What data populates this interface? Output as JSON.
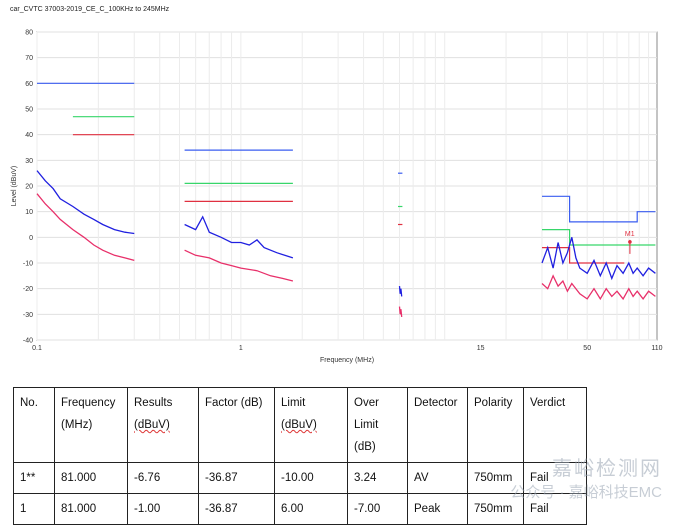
{
  "chart_data": {
    "type": "line",
    "title": "car_CVTC 37003-2019_CE_C_100KHz to 245MHz",
    "xlabel": "Frequency (MHz)",
    "ylabel": "Level (dBuV)",
    "xscale": "log",
    "xlim": [
      0.1,
      110
    ],
    "ylim": [
      -40,
      80
    ],
    "yticks": [
      80,
      70,
      60,
      50,
      40,
      30,
      20,
      10,
      0,
      -10,
      -20,
      -30,
      -40
    ],
    "xticks": [
      0.1,
      1,
      15,
      50,
      110
    ],
    "xtick_labels": [
      "0.1",
      "1",
      "15",
      "50",
      "110"
    ],
    "grid": true,
    "limit_lines": [
      {
        "color": "#3a5df0",
        "points": [
          [
            0.1,
            60
          ],
          [
            0.3,
            60
          ]
        ]
      },
      {
        "color": "#37d66a",
        "points": [
          [
            0.15,
            47
          ],
          [
            0.3,
            47
          ]
        ]
      },
      {
        "color": "#e03040",
        "points": [
          [
            0.15,
            40
          ],
          [
            0.3,
            40
          ]
        ]
      },
      {
        "color": "#3a5df0",
        "points": [
          [
            0.53,
            34
          ],
          [
            1.8,
            34
          ]
        ]
      },
      {
        "color": "#37d66a",
        "points": [
          [
            0.53,
            21
          ],
          [
            1.8,
            21
          ]
        ]
      },
      {
        "color": "#e03040",
        "points": [
          [
            0.53,
            14
          ],
          [
            1.8,
            14
          ]
        ]
      },
      {
        "color": "#3a5df0",
        "points": [
          [
            5.9,
            25
          ],
          [
            6.2,
            25
          ]
        ]
      },
      {
        "color": "#37d66a",
        "points": [
          [
            5.9,
            12
          ],
          [
            6.2,
            12
          ]
        ]
      },
      {
        "color": "#e03040",
        "points": [
          [
            5.9,
            5
          ],
          [
            6.2,
            5
          ]
        ]
      },
      {
        "color": "#3a5df0",
        "points": [
          [
            30,
            16
          ],
          [
            41,
            16
          ],
          [
            41,
            6
          ],
          [
            76,
            6
          ],
          [
            76,
            6
          ],
          [
            88,
            6
          ],
          [
            88,
            10
          ],
          [
            108,
            10
          ]
        ]
      },
      {
        "color": "#37d66a",
        "points": [
          [
            30,
            3
          ],
          [
            41,
            3
          ],
          [
            41,
            -3
          ],
          [
            76,
            -3
          ],
          [
            76,
            -3
          ],
          [
            108,
            -3
          ]
        ]
      },
      {
        "color": "#e03040",
        "points": [
          [
            30,
            -4
          ],
          [
            41,
            -4
          ],
          [
            41,
            -10
          ],
          [
            76,
            -10
          ]
        ]
      }
    ],
    "series": [
      {
        "color": "#2020e0",
        "points": [
          [
            0.1,
            26
          ],
          [
            0.11,
            22
          ],
          [
            0.12,
            19
          ],
          [
            0.13,
            15
          ],
          [
            0.15,
            12
          ],
          [
            0.17,
            9
          ],
          [
            0.19,
            7
          ],
          [
            0.21,
            5
          ],
          [
            0.24,
            3
          ],
          [
            0.27,
            2
          ],
          [
            0.3,
            1.5
          ]
        ]
      },
      {
        "color": "#e8306a",
        "points": [
          [
            0.1,
            17
          ],
          [
            0.11,
            13
          ],
          [
            0.12,
            10
          ],
          [
            0.13,
            7
          ],
          [
            0.15,
            3
          ],
          [
            0.17,
            0
          ],
          [
            0.19,
            -3
          ],
          [
            0.21,
            -5
          ],
          [
            0.24,
            -7
          ],
          [
            0.27,
            -8
          ],
          [
            0.3,
            -9
          ]
        ]
      },
      {
        "color": "#2020e0",
        "points": [
          [
            0.53,
            5
          ],
          [
            0.6,
            3
          ],
          [
            0.65,
            8
          ],
          [
            0.7,
            2
          ],
          [
            0.8,
            0
          ],
          [
            0.9,
            -2
          ],
          [
            1.0,
            -2
          ],
          [
            1.1,
            -3
          ],
          [
            1.2,
            -1
          ],
          [
            1.3,
            -4
          ],
          [
            1.5,
            -6
          ],
          [
            1.8,
            -8
          ]
        ]
      },
      {
        "color": "#e8306a",
        "points": [
          [
            0.53,
            -5
          ],
          [
            0.6,
            -7
          ],
          [
            0.7,
            -8
          ],
          [
            0.8,
            -10
          ],
          [
            0.9,
            -11
          ],
          [
            1.0,
            -12
          ],
          [
            1.2,
            -13
          ],
          [
            1.4,
            -15
          ],
          [
            1.6,
            -16
          ],
          [
            1.8,
            -17
          ]
        ]
      },
      {
        "color": "#2020e0",
        "points": [
          [
            6.0,
            -19
          ],
          [
            6.05,
            -22
          ],
          [
            6.1,
            -20
          ],
          [
            6.15,
            -23
          ]
        ]
      },
      {
        "color": "#e8306a",
        "points": [
          [
            6.0,
            -27
          ],
          [
            6.05,
            -30
          ],
          [
            6.1,
            -28
          ],
          [
            6.15,
            -31
          ]
        ]
      },
      {
        "color": "#2020e0",
        "points": [
          [
            30,
            -10
          ],
          [
            32,
            -4
          ],
          [
            34,
            -12
          ],
          [
            36,
            -2
          ],
          [
            38,
            -10
          ],
          [
            40,
            -6
          ],
          [
            42,
            0
          ],
          [
            44,
            -8
          ],
          [
            46,
            -12
          ],
          [
            50,
            -14
          ],
          [
            54,
            -9
          ],
          [
            58,
            -15
          ],
          [
            62,
            -10
          ],
          [
            66,
            -16
          ],
          [
            70,
            -11
          ],
          [
            75,
            -14
          ],
          [
            80,
            -10
          ],
          [
            84,
            -14
          ],
          [
            88,
            -12
          ],
          [
            94,
            -15
          ],
          [
            100,
            -12
          ],
          [
            108,
            -14
          ]
        ]
      },
      {
        "color": "#e8306a",
        "points": [
          [
            30,
            -18
          ],
          [
            32,
            -20
          ],
          [
            34,
            -15
          ],
          [
            36,
            -19
          ],
          [
            38,
            -17
          ],
          [
            40,
            -21
          ],
          [
            42,
            -18
          ],
          [
            46,
            -22
          ],
          [
            50,
            -24
          ],
          [
            54,
            -20
          ],
          [
            58,
            -24
          ],
          [
            62,
            -20
          ],
          [
            66,
            -23
          ],
          [
            70,
            -21
          ],
          [
            75,
            -24
          ],
          [
            80,
            -20
          ],
          [
            84,
            -23
          ],
          [
            88,
            -21
          ],
          [
            94,
            -24
          ],
          [
            100,
            -21
          ],
          [
            108,
            -23
          ]
        ]
      }
    ],
    "annotations": [
      {
        "label": "M1",
        "x": 81,
        "y": -1
      }
    ]
  },
  "table": {
    "headers": [
      [
        "No."
      ],
      [
        "Frequency",
        "(MHz)"
      ],
      [
        "Results",
        "(dBuV)"
      ],
      [
        "Factor (dB)"
      ],
      [
        "Limit",
        "(dBuV)"
      ],
      [
        "Over",
        "Limit",
        "(dB)"
      ],
      [
        "Detector"
      ],
      [
        "Polarity"
      ],
      [
        "Verdict"
      ]
    ],
    "rows": [
      [
        "1**",
        "81.000",
        "-6.76",
        "-36.87",
        "-10.00",
        "3.24",
        "AV",
        "750mm",
        "Fail"
      ],
      [
        "1",
        "81.000",
        "-1.00",
        "-36.87",
        "6.00",
        "-7.00",
        "Peak",
        "750mm",
        "Fail"
      ]
    ]
  },
  "watermark": {
    "line1": "嘉峪检测网",
    "line2": "公众号 · 嘉峪科技EMC"
  }
}
